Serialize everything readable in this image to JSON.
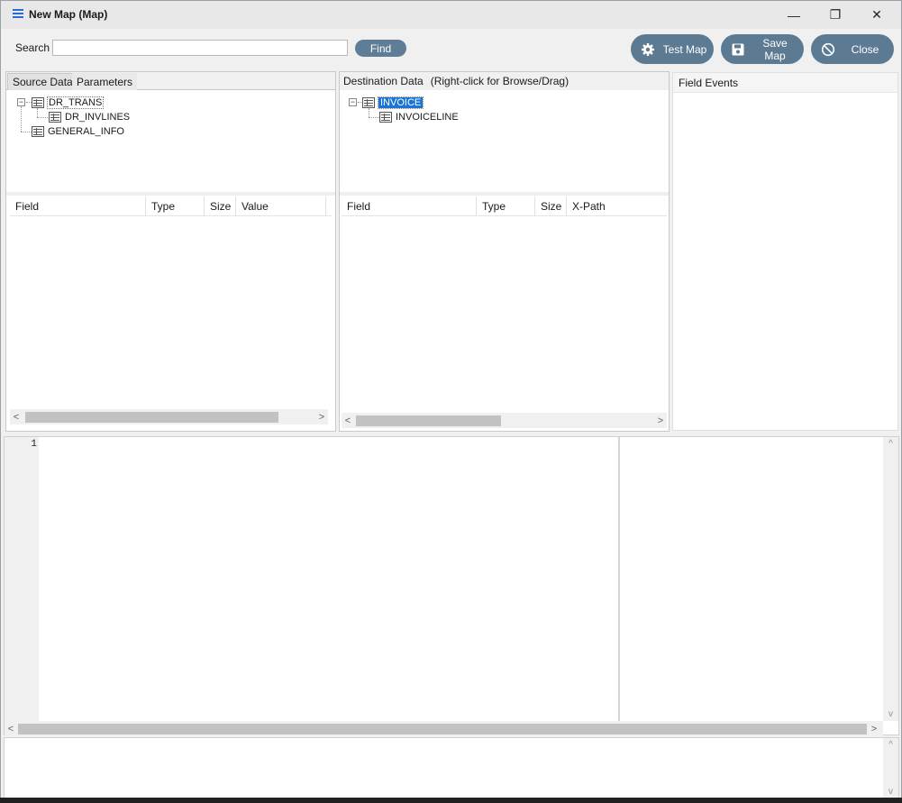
{
  "window": {
    "title": "New Map (Map)",
    "controls": {
      "minimize": "—",
      "maximize": "❐",
      "close": "✕"
    }
  },
  "toolbar": {
    "search_label": "Search",
    "search_value": "",
    "find_label": "Find",
    "test_map_label": "Test Map",
    "save_map_label": "Save Map",
    "close_label": "Close",
    "accent_color": "#5c7a92"
  },
  "source": {
    "tabs": [
      "Source Data",
      "Parameters"
    ],
    "tree": {
      "root": "DR_TRANS",
      "child": "DR_INVLINES",
      "sibling": "GENERAL_INFO"
    },
    "columns": [
      "Field",
      "Type",
      "Size",
      "Value"
    ]
  },
  "destination": {
    "title": "Destination Data",
    "hint": "(Right-click for Browse/Drag)",
    "tree": {
      "root": "INVOICE",
      "child": "INVOICELINE"
    },
    "columns": [
      "Field",
      "Type",
      "Size",
      "X-Path"
    ]
  },
  "events": {
    "title": "Field Events"
  },
  "editor": {
    "line_numbers": [
      "1"
    ]
  },
  "icons": {
    "app": "hamburger-icon",
    "test": "gear-icon",
    "save": "floppy-icon",
    "close": "prohibit-icon",
    "table": "table-icon"
  }
}
